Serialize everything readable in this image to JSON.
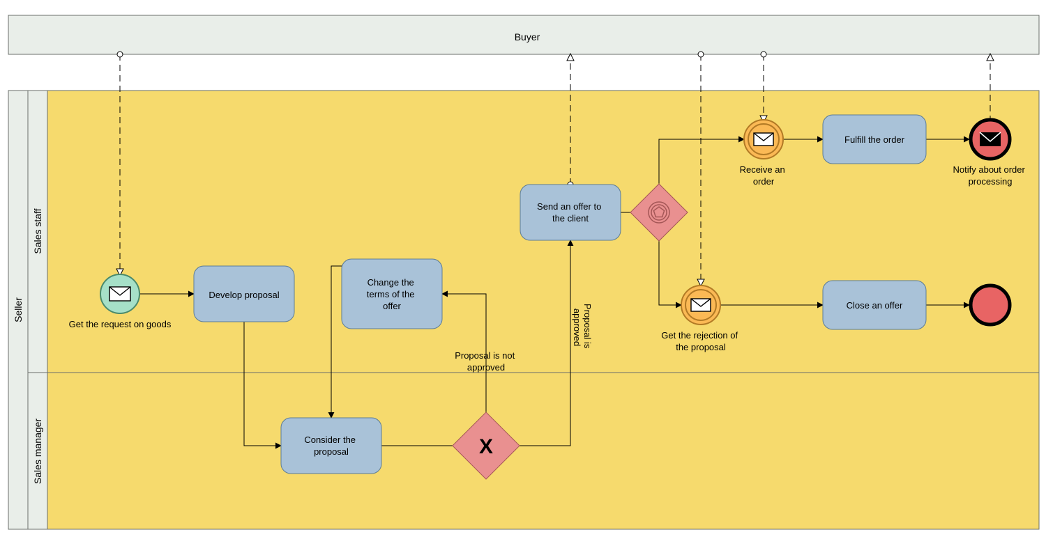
{
  "pool_buyer": "Buyer",
  "pool_seller": "Seller",
  "lane_sales_staff": "Sales staff",
  "lane_sales_manager": "Sales manager",
  "events": {
    "start": "Get the request on goods",
    "receive_order": "Receive an order",
    "get_rejection": "Get the rejection of the proposal",
    "notify_processing": "Notify about order processing"
  },
  "tasks": {
    "develop_proposal": "Develop proposal",
    "change_terms": "Change the terms of the offer",
    "consider_proposal": "Consider the proposal",
    "send_offer": "Send an offer to the client",
    "fulfill_order": "Fulfill the order",
    "close_offer": "Close an offer"
  },
  "labels": {
    "proposal_not_approved": "Proposal is not approved",
    "proposal_approved": "Proposal is approved"
  }
}
